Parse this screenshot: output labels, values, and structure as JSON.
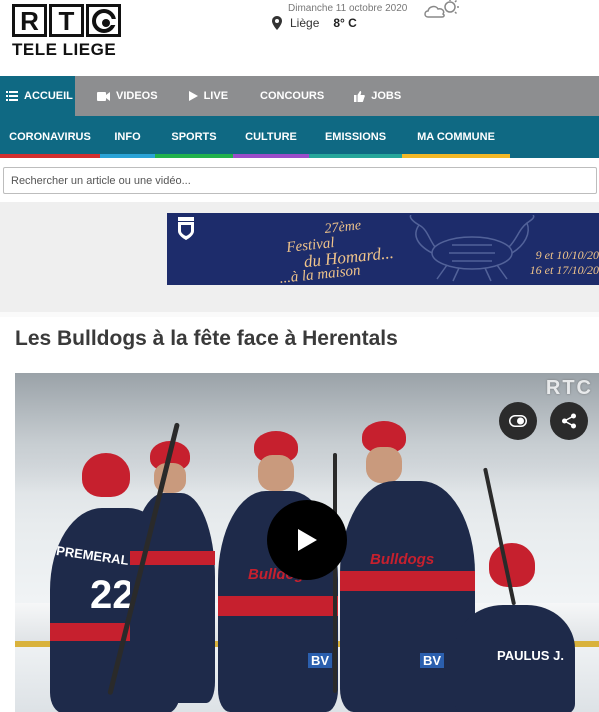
{
  "header": {
    "logo_letters": [
      "R",
      "T",
      "C"
    ],
    "logo_subtitle": "TELE LIEGE",
    "date": "Dimanche 11 octobre 2020",
    "city": "Liège",
    "temperature": "8° C",
    "weather_icon": "partly-cloudy-icon"
  },
  "nav_primary": [
    {
      "label": "ACCUEIL",
      "icon": "list-icon",
      "active": true
    },
    {
      "label": "VIDEOS",
      "icon": "video-camera-icon",
      "active": false
    },
    {
      "label": "LIVE",
      "icon": "play-icon",
      "active": false
    },
    {
      "label": "CONCOURS",
      "icon": "",
      "active": false
    },
    {
      "label": "JOBS",
      "icon": "thumbs-up-icon",
      "active": false
    }
  ],
  "nav_secondary": [
    {
      "label": "CORONAVIRUS",
      "color": "#d32f2f"
    },
    {
      "label": "INFO",
      "color": "#2aa3d6"
    },
    {
      "label": "SPORTS",
      "color": "#21b14c"
    },
    {
      "label": "CULTURE",
      "color": "#9b4dca"
    },
    {
      "label": "EMISSIONS",
      "color": "#26a69a"
    },
    {
      "label": "MA COMMUNE",
      "color": "#f2b827"
    }
  ],
  "search": {
    "placeholder": "Rechercher un article ou une vidéo..."
  },
  "ad": {
    "title_lines": [
      "27ème",
      "Festival",
      "du Homard...",
      "...à la maison"
    ],
    "dates_lines": [
      "9 et 10/10/20",
      "16 et 17/10/20"
    ]
  },
  "article": {
    "title": "Les Bulldogs à la fête face à Herentals",
    "video_watermark": "RTC",
    "jersey_text": [
      "PREMERAL",
      "PAULUS J.",
      "Bulldogs",
      "Bulldogs",
      "Bulldogs",
      "Bulldogs",
      "BV",
      "BV"
    ]
  },
  "colors": {
    "nav_primary_bg": "#8d8e90",
    "brand_teal": "#0f6983",
    "ad_navy": "#1d2c6b",
    "ad_gold": "#f0c48a",
    "jersey_red": "#c6202e",
    "jersey_navy": "#1e2a4a"
  }
}
